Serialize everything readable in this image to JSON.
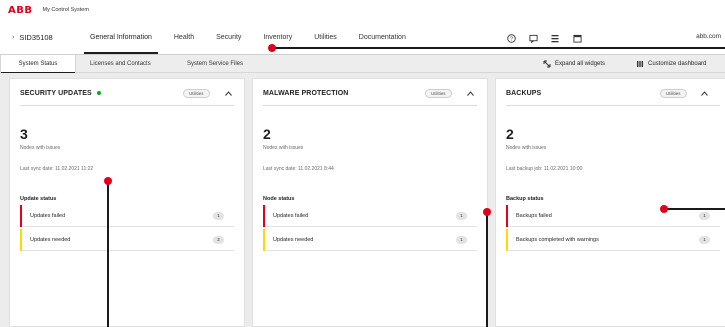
{
  "app": {
    "logo": "ABB",
    "title": "My Control System"
  },
  "nav": {
    "breadcrumb": "SID35108",
    "tabs": [
      {
        "label": "General Information",
        "active": true
      },
      {
        "label": "Health",
        "active": false
      },
      {
        "label": "Security",
        "active": false
      },
      {
        "label": "Inventory",
        "active": false
      },
      {
        "label": "Utilities",
        "active": false
      },
      {
        "label": "Documentation",
        "active": false
      }
    ],
    "icons": [
      "help-icon",
      "chat-icon",
      "menu-icon",
      "calendar-icon"
    ],
    "user": "abb.com"
  },
  "subbar": {
    "tabs": [
      {
        "label": "System Status",
        "active": true
      },
      {
        "label": "Licenses and Contacts",
        "active": false
      },
      {
        "label": "System Service Files",
        "active": false
      }
    ],
    "expand_label": "Expand all widgets",
    "customize_label": "Customize dashboard"
  },
  "cards": [
    {
      "title": "SECURITY UPDATES",
      "status_dot": true,
      "pill": "Utilities",
      "count": "3",
      "count_label": "Nodes with issues",
      "sync": "Last sync date: 11.02.2021 11:22",
      "status_title": "Update status",
      "rows": [
        {
          "label": "Updates failed",
          "count": "1",
          "color": "#e2001a"
        },
        {
          "label": "Updates needed",
          "count": "2",
          "color": "#ffd800"
        }
      ]
    },
    {
      "title": "MALWARE PROTECTION",
      "status_dot": false,
      "pill": "Utilities",
      "count": "2",
      "count_label": "Nodes with issues",
      "sync": "Last sync date: 11.02.2021 8:44",
      "status_title": "Node status",
      "rows": [
        {
          "label": "Updates failed",
          "count": "1",
          "color": "#e2001a"
        },
        {
          "label": "Updates needed",
          "count": "1",
          "color": "#ffd800"
        }
      ]
    },
    {
      "title": "BACKUPS",
      "status_dot": false,
      "pill": "Utilities",
      "count": "2",
      "count_label": "Nodes with issues",
      "sync": "Last backup job: 11.02.2021 10:00",
      "status_title": "Backup status",
      "rows": [
        {
          "label": "Backups failed",
          "count": "1",
          "color": "#e2001a"
        },
        {
          "label": "Backups completed with warnings",
          "count": "1",
          "color": "#ffd800"
        }
      ]
    }
  ],
  "colors": {
    "accent": "#e2001a",
    "warning": "#ffd800",
    "ok": "#0ca919"
  }
}
